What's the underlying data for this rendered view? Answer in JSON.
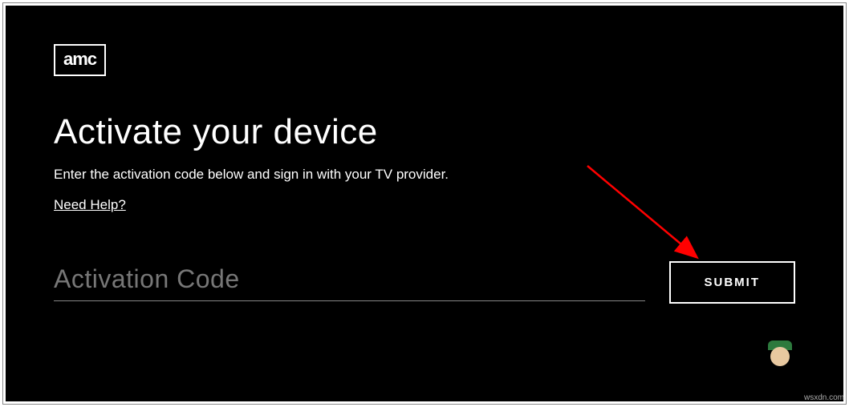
{
  "logo": {
    "text": "amc"
  },
  "header": {
    "title": "Activate your device",
    "subtitle": "Enter the activation code below and sign in with your TV provider.",
    "help_link": "Need Help?"
  },
  "form": {
    "input_placeholder": "Activation Code",
    "input_value": "",
    "submit_label": "SUBMIT"
  },
  "watermark": "wsxdn.com"
}
